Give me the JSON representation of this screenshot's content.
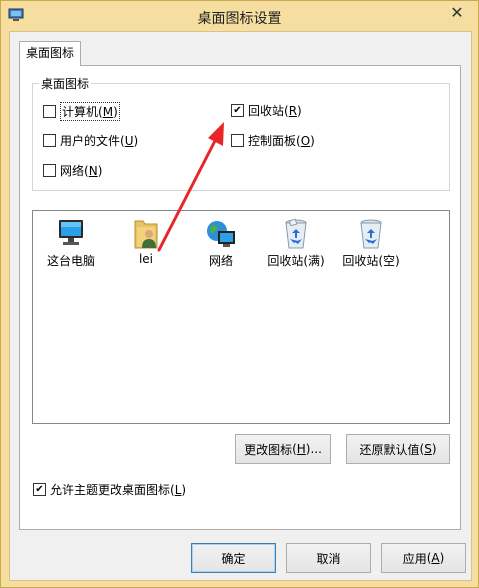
{
  "window": {
    "title": "桌面图标设置"
  },
  "tab": {
    "label": "桌面图标"
  },
  "group": {
    "title": "桌面图标",
    "checkboxes": [
      {
        "label": "计算机",
        "key": "M",
        "checked": false
      },
      {
        "label": "回收站",
        "key": "R",
        "checked": true
      },
      {
        "label": "用户的文件",
        "key": "U",
        "checked": false
      },
      {
        "label": "控制面板",
        "key": "O",
        "checked": false
      },
      {
        "label": "网络",
        "key": "N",
        "checked": false
      }
    ]
  },
  "icons": [
    {
      "label": "这台电脑",
      "icon": "computer-icon"
    },
    {
      "label": "lei",
      "icon": "user-folder-icon"
    },
    {
      "label": "网络",
      "icon": "network-icon"
    },
    {
      "label": "回收站(满)",
      "icon": "recycle-bin-full-icon"
    },
    {
      "label": "回收站(空)",
      "icon": "recycle-bin-empty-icon"
    }
  ],
  "buttons": {
    "change_icon": {
      "label": "更改图标",
      "key": "H",
      "suffix": "..."
    },
    "restore_default": {
      "label": "还原默认值",
      "key": "S"
    },
    "ok": "确定",
    "cancel": "取消",
    "apply": {
      "label": "应用",
      "key": "A"
    }
  },
  "allow_theme": {
    "label": "允许主题更改桌面图标",
    "key": "L",
    "checked": true
  },
  "checkmark": "✔",
  "close_glyph": "✕",
  "colors": {
    "titlebar": "#f6dea0",
    "arrow": "#e8262a",
    "default_button_border": "#3c7fb1"
  }
}
